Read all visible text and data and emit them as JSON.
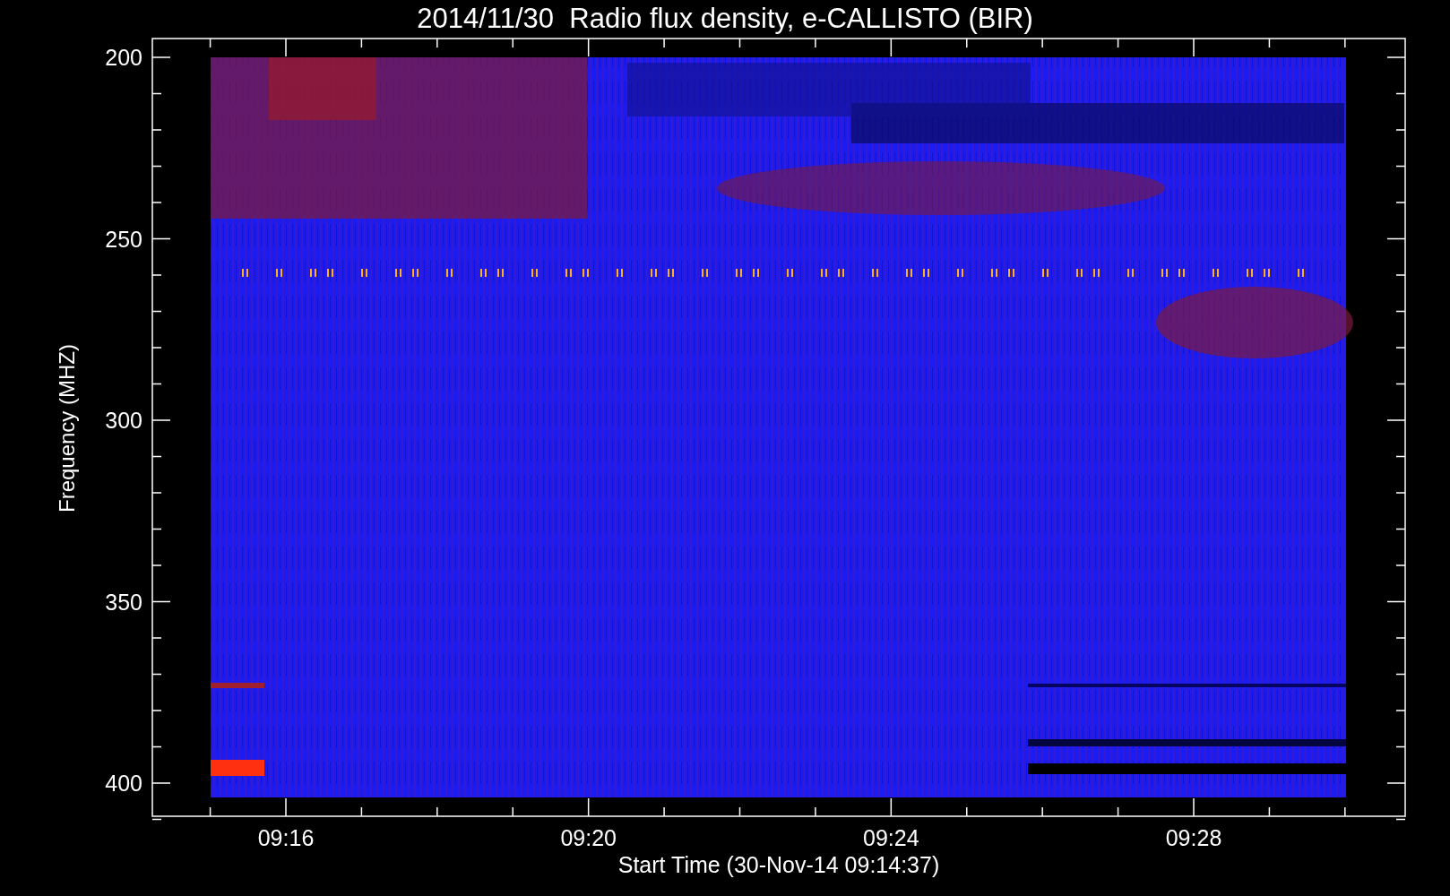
{
  "title": "2014/11/30  Radio flux density, e-CALLISTO (BIR)",
  "y_axis": {
    "label": "Frequency (MHZ)",
    "ticks": [
      "200",
      "250",
      "300",
      "350",
      "400"
    ]
  },
  "x_axis": {
    "label": "Start Time (30-Nov-14 09:14:37)",
    "ticks": [
      "09:16",
      "09:20",
      "09:24",
      "09:28"
    ]
  }
}
